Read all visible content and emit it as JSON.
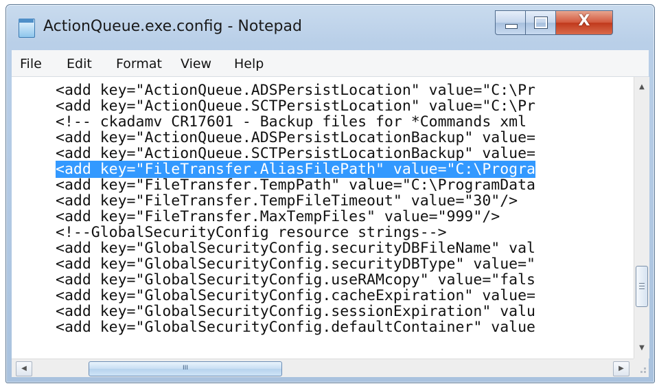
{
  "window": {
    "title": "ActionQueue.exe.config - Notepad",
    "close_glyph": "X"
  },
  "menu": {
    "items": [
      "File",
      "Edit",
      "Format",
      "View",
      "Help"
    ]
  },
  "editor": {
    "lines": [
      "<add key=\"ActionQueue.ADSPersistLocation\" value=\"C:\\Pr",
      "<add key=\"ActionQueue.SCTPersistLocation\" value=\"C:\\Pr",
      "<!-- ckadamv CR17601 - Backup files for *Commands xml",
      "<add key=\"ActionQueue.ADSPersistLocationBackup\" value=",
      "<add key=\"ActionQueue.SCTPersistLocationBackup\" value=",
      "<add key=\"FileTransfer.AliasFilePath\" value=\"C:\\Progra",
      "<add key=\"FileTransfer.TempPath\" value=\"C:\\ProgramData",
      "<add key=\"FileTransfer.TempFileTimeout\" value=\"30\"/>",
      "<add key=\"FileTransfer.MaxTempFiles\" value=\"999\"/>",
      "<!--GlobalSecurityConfig resource strings-->",
      "<add key=\"GlobalSecurityConfig.securityDBFileName\" val",
      "<add key=\"GlobalSecurityConfig.securityDBType\" value=\"",
      "<add key=\"GlobalSecurityConfig.useRAMcopy\" value=\"fals",
      "<add key=\"GlobalSecurityConfig.cacheExpiration\" value=",
      "<add key=\"GlobalSecurityConfig.sessionExpiration\" valu",
      "<add key=\"GlobalSecurityConfig.defaultContainer\" value"
    ],
    "selected_line_index": 5
  },
  "scrollbars": {
    "up_arrow": "▲",
    "down_arrow": "▼",
    "left_arrow": "◀",
    "right_arrow": "▶",
    "h_grip": "III"
  },
  "colors": {
    "selection": "#3399ff",
    "close_button": "#c0391c"
  }
}
